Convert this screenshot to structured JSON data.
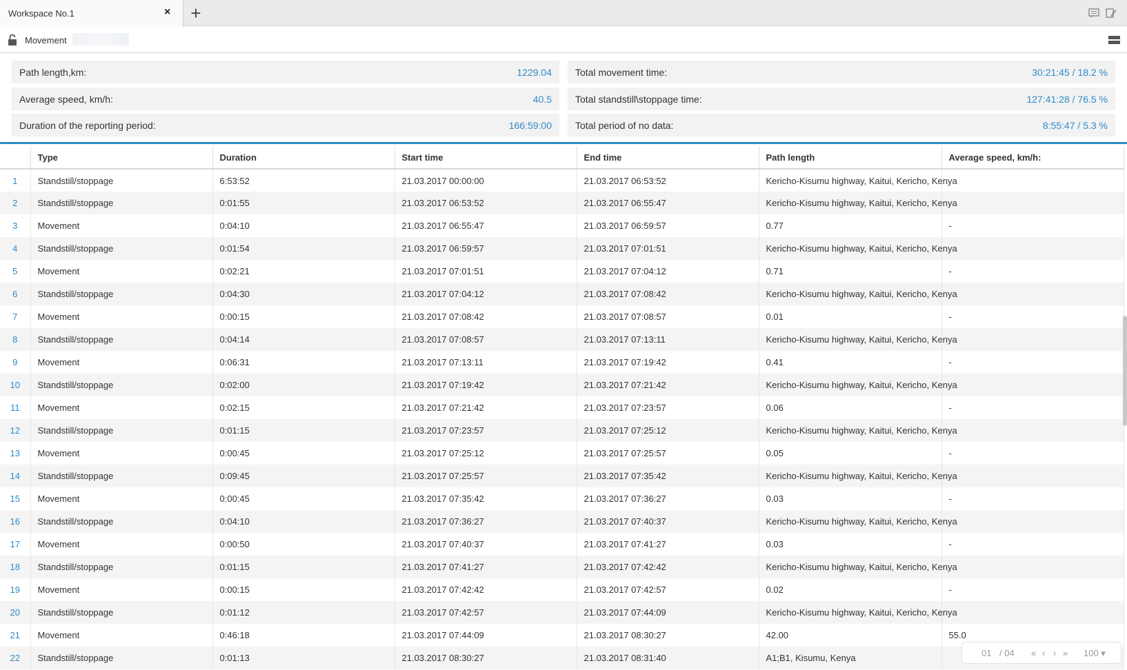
{
  "tabbar": {
    "tab_title": "Workspace No.1",
    "close_glyph": "×",
    "add_glyph": "+",
    "icons": [
      "messages-icon",
      "edit-note-icon"
    ]
  },
  "toolbar": {
    "lock_icon": "unlock-icon",
    "report_name": "Movement",
    "menu_icon": "menu-icon"
  },
  "summary": {
    "left": [
      {
        "label": "Path length,km:",
        "value": "1229.04"
      },
      {
        "label": "Average speed, km/h:",
        "value": "40.5"
      },
      {
        "label": "Duration of the reporting period:",
        "value": "166:59:00"
      }
    ],
    "right": [
      {
        "label": "Total movement time:",
        "value": "30:21:45 / 18.2 %"
      },
      {
        "label": "Total standstill\\stoppage time:",
        "value": "127:41:28 / 76.5 %"
      },
      {
        "label": "Total period of no data:",
        "value": "8:55:47 / 5.3 %"
      }
    ]
  },
  "colors": {
    "accent": "#2e8bc9",
    "row_alt": "#f4f4f4",
    "summary_bg": "#f2f2f2"
  },
  "table": {
    "headers": [
      "",
      "Type",
      "Duration",
      "Start time",
      "End time",
      "Path length",
      "Average speed, km/h:"
    ],
    "rows": [
      [
        "1",
        "Standstill/stoppage",
        "6:53:52",
        "21.03.2017 00:00:00",
        "21.03.2017 06:53:52",
        "Kericho-Kisumu highway, Kaitui, Kericho, Kenya",
        ""
      ],
      [
        "2",
        "Standstill/stoppage",
        "0:01:55",
        "21.03.2017 06:53:52",
        "21.03.2017 06:55:47",
        "Kericho-Kisumu highway, Kaitui, Kericho, Kenya",
        ""
      ],
      [
        "3",
        "Movement",
        "0:04:10",
        "21.03.2017 06:55:47",
        "21.03.2017 06:59:57",
        "0.77",
        "-"
      ],
      [
        "4",
        "Standstill/stoppage",
        "0:01:54",
        "21.03.2017 06:59:57",
        "21.03.2017 07:01:51",
        "Kericho-Kisumu highway, Kaitui, Kericho, Kenya",
        ""
      ],
      [
        "5",
        "Movement",
        "0:02:21",
        "21.03.2017 07:01:51",
        "21.03.2017 07:04:12",
        "0.71",
        "-"
      ],
      [
        "6",
        "Standstill/stoppage",
        "0:04:30",
        "21.03.2017 07:04:12",
        "21.03.2017 07:08:42",
        "Kericho-Kisumu highway, Kaitui, Kericho, Kenya",
        ""
      ],
      [
        "7",
        "Movement",
        "0:00:15",
        "21.03.2017 07:08:42",
        "21.03.2017 07:08:57",
        "0.01",
        "-"
      ],
      [
        "8",
        "Standstill/stoppage",
        "0:04:14",
        "21.03.2017 07:08:57",
        "21.03.2017 07:13:11",
        "Kericho-Kisumu highway, Kaitui, Kericho, Kenya",
        ""
      ],
      [
        "9",
        "Movement",
        "0:06:31",
        "21.03.2017 07:13:11",
        "21.03.2017 07:19:42",
        "0.41",
        "-"
      ],
      [
        "10",
        "Standstill/stoppage",
        "0:02:00",
        "21.03.2017 07:19:42",
        "21.03.2017 07:21:42",
        "Kericho-Kisumu highway, Kaitui, Kericho, Kenya",
        ""
      ],
      [
        "11",
        "Movement",
        "0:02:15",
        "21.03.2017 07:21:42",
        "21.03.2017 07:23:57",
        "0.06",
        "-"
      ],
      [
        "12",
        "Standstill/stoppage",
        "0:01:15",
        "21.03.2017 07:23:57",
        "21.03.2017 07:25:12",
        "Kericho-Kisumu highway, Kaitui, Kericho, Kenya",
        ""
      ],
      [
        "13",
        "Movement",
        "0:00:45",
        "21.03.2017 07:25:12",
        "21.03.2017 07:25:57",
        "0.05",
        "-"
      ],
      [
        "14",
        "Standstill/stoppage",
        "0:09:45",
        "21.03.2017 07:25:57",
        "21.03.2017 07:35:42",
        "Kericho-Kisumu highway, Kaitui, Kericho, Kenya",
        ""
      ],
      [
        "15",
        "Movement",
        "0:00:45",
        "21.03.2017 07:35:42",
        "21.03.2017 07:36:27",
        "0.03",
        "-"
      ],
      [
        "16",
        "Standstill/stoppage",
        "0:04:10",
        "21.03.2017 07:36:27",
        "21.03.2017 07:40:37",
        "Kericho-Kisumu highway, Kaitui, Kericho, Kenya",
        ""
      ],
      [
        "17",
        "Movement",
        "0:00:50",
        "21.03.2017 07:40:37",
        "21.03.2017 07:41:27",
        "0.03",
        "-"
      ],
      [
        "18",
        "Standstill/stoppage",
        "0:01:15",
        "21.03.2017 07:41:27",
        "21.03.2017 07:42:42",
        "Kericho-Kisumu highway, Kaitui, Kericho, Kenya",
        ""
      ],
      [
        "19",
        "Movement",
        "0:00:15",
        "21.03.2017 07:42:42",
        "21.03.2017 07:42:57",
        "0.02",
        "-"
      ],
      [
        "20",
        "Standstill/stoppage",
        "0:01:12",
        "21.03.2017 07:42:57",
        "21.03.2017 07:44:09",
        "Kericho-Kisumu highway, Kaitui, Kericho, Kenya",
        ""
      ],
      [
        "21",
        "Movement",
        "0:46:18",
        "21.03.2017 07:44:09",
        "21.03.2017 08:30:27",
        "42.00",
        "55.0"
      ],
      [
        "22",
        "Standstill/stoppage",
        "0:01:13",
        "21.03.2017 08:30:27",
        "21.03.2017 08:31:40",
        "A1;B1, Kisumu, Kenya",
        ""
      ]
    ]
  },
  "pager": {
    "current": "01",
    "total": "/ 04",
    "first": "«",
    "prev": "‹",
    "next": "›",
    "last": "»",
    "page_size": "100 ▾"
  }
}
